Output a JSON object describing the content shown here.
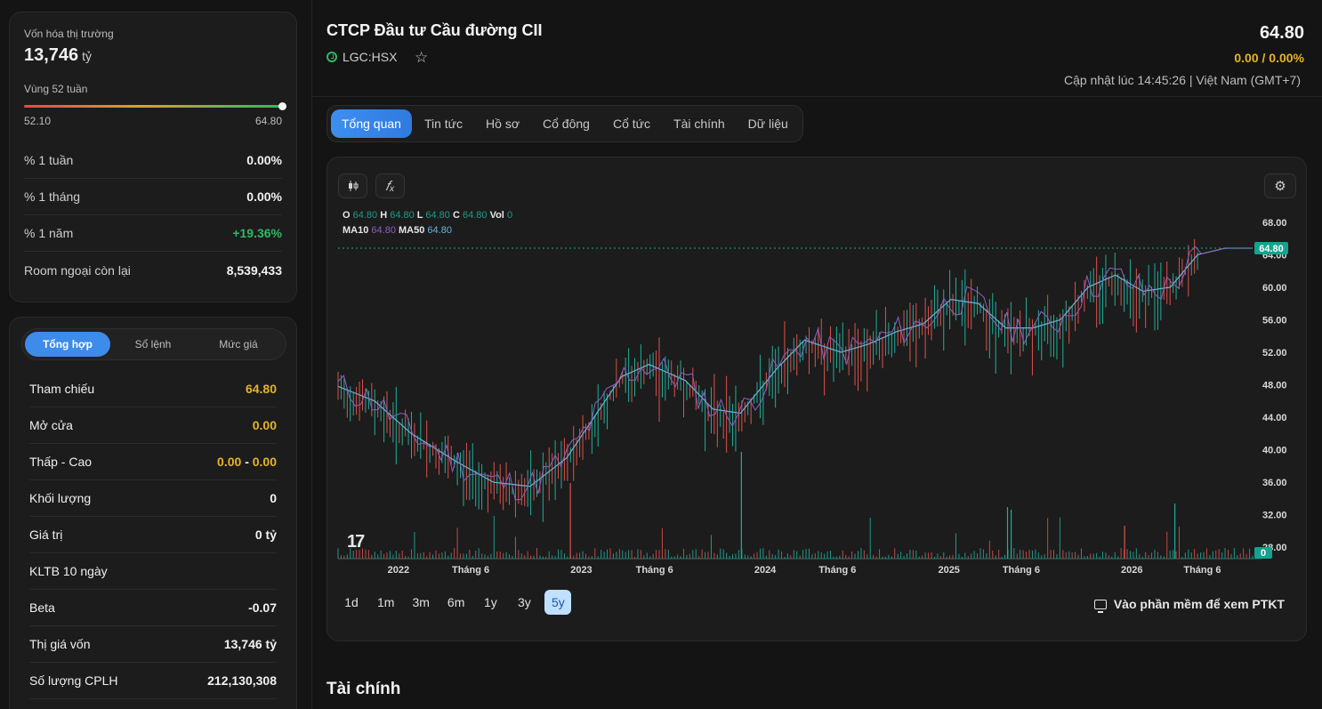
{
  "left_top": {
    "market_cap_label": "Vốn hóa thị trường",
    "market_cap_value": "13,746",
    "market_cap_unit": "tỷ",
    "range_label": "Vùng 52 tuần",
    "range_low": "52.10",
    "range_high": "64.80",
    "range_position": 1.0,
    "rows": [
      {
        "label": "% 1 tuần",
        "value": "0.00%"
      },
      {
        "label": "% 1 tháng",
        "value": "0.00%"
      },
      {
        "label": "% 1 năm",
        "value": "+19.36%"
      },
      {
        "label": "Room ngoại còn lại",
        "value": "8,539,433"
      }
    ]
  },
  "left_bottom": {
    "tabs": [
      "Tổng hợp",
      "Sổ lệnh",
      "Mức giá"
    ],
    "active_tab": "Tổng hợp",
    "rows": [
      {
        "label": "Tham chiếu",
        "value": "64.80"
      },
      {
        "label": "Mở cửa",
        "value": "0.00"
      },
      {
        "label": "Thấp - Cao",
        "low": "0.00",
        "sep": "-",
        "high": "0.00"
      },
      {
        "label": "Khối lượng",
        "value": "0"
      },
      {
        "label": "Giá trị",
        "value": "0 tỷ"
      },
      {
        "label": "KLTB 10 ngày",
        "value": ""
      },
      {
        "label": "Beta",
        "value": "-0.07"
      },
      {
        "label": "Thị giá vốn",
        "value": "13,746 tỷ"
      },
      {
        "label": "Số lượng CPLH",
        "value": "212,130,308"
      }
    ]
  },
  "header": {
    "title": "CTCP Đầu tư Cầu đường CII",
    "ticker": "LGC:HSX",
    "price": "64.80",
    "change": "0.00 / 0.00%",
    "updated": "Cập nhật lúc 14:45:26 | Việt Nam (GMT+7)"
  },
  "tabs": [
    "Tổng quan",
    "Tin tức",
    "Hồ sơ",
    "Cổ đông",
    "Cổ tức",
    "Tài chính",
    "Dữ liệu"
  ],
  "active_tab": "Tổng quan",
  "chart": {
    "ohlc": {
      "O": "64.80",
      "H": "64.80",
      "L": "64.80",
      "C": "64.80",
      "Vol": "0"
    },
    "ma": {
      "MA10": "64.80",
      "MA50": "64.80"
    },
    "last_price_label": "64.80",
    "last_volume_label": "0",
    "watermark": "17",
    "ranges": [
      "1d",
      "1m",
      "3m",
      "6m",
      "1y",
      "3y",
      "5y"
    ],
    "active_range": "5y",
    "ptkt_label": "Vào phần mềm để xem PTKT",
    "colors": {
      "up": "#1fae9a",
      "down": "#e0504a",
      "ma10": "#8e5fbf",
      "ma50": "#65b7d9",
      "badge": "#14a38d"
    }
  },
  "chart_data": {
    "type": "line",
    "x_tick_labels": [
      "2022",
      "Tháng 6",
      "2023",
      "Tháng 6",
      "2024",
      "Tháng 6",
      "2025",
      "Tháng 6",
      "2026",
      "Tháng 6"
    ],
    "y_tick_labels": [
      "68.00",
      "64.00",
      "60.00",
      "56.00",
      "52.00",
      "48.00",
      "44.00",
      "40.00",
      "36.00",
      "32.00",
      "28.00"
    ],
    "ylim": [
      26.6,
      69.4
    ],
    "series": [
      {
        "name": "MA50",
        "x_fraction": [
          0,
          0.04,
          0.08,
          0.13,
          0.17,
          0.21,
          0.25,
          0.28,
          0.31,
          0.34,
          0.38,
          0.41,
          0.44,
          0.48,
          0.51,
          0.55,
          0.58,
          0.61,
          0.64,
          0.67,
          0.7,
          0.73,
          0.76,
          0.79,
          0.82,
          0.85,
          0.88,
          0.91,
          0.94,
          0.97,
          1.0
        ],
        "values": [
          47.8,
          46.0,
          42.0,
          38.5,
          36.0,
          35.5,
          39.0,
          44.0,
          49.0,
          50.5,
          48.5,
          45.0,
          44.5,
          50.0,
          53.5,
          52.0,
          53.0,
          54.5,
          55.5,
          58.5,
          58.0,
          55.0,
          55.0,
          56.0,
          60.0,
          61.5,
          59.5,
          60.0,
          64.0,
          64.8,
          64.8
        ]
      }
    ]
  }
}
